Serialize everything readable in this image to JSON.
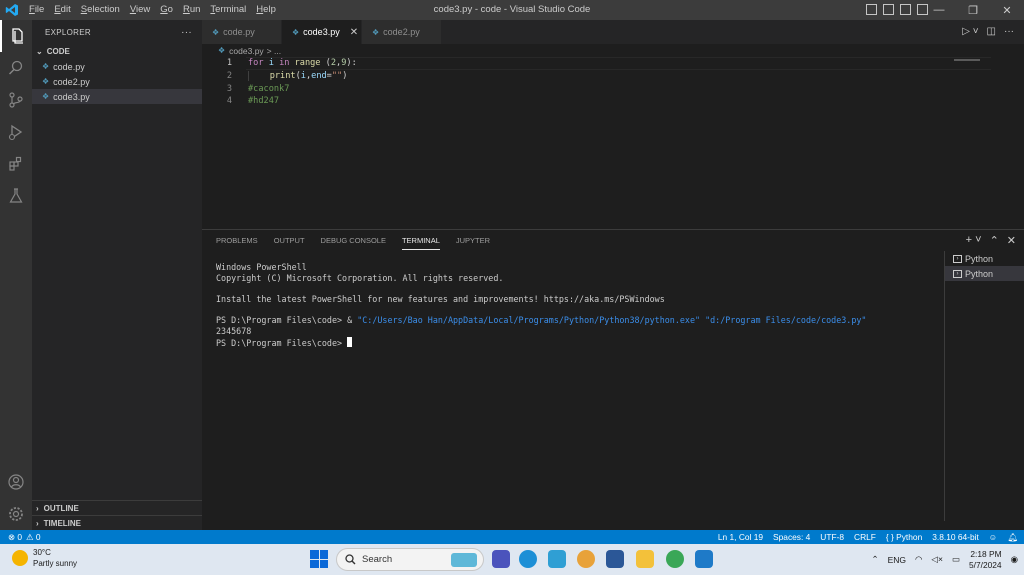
{
  "titlebar": {
    "menu": [
      "File",
      "Edit",
      "Selection",
      "View",
      "Go",
      "Run",
      "Terminal",
      "Help"
    ],
    "title": "code3.py - code - Visual Studio Code",
    "window_controls": [
      "—",
      "❐",
      "✕"
    ]
  },
  "colors": {
    "accent": "#007acc",
    "editor_bg": "#1e1e1e",
    "sidebar_bg": "#252526",
    "activitybar_bg": "#333333"
  },
  "activitybar": [
    "explorer-icon",
    "search-icon",
    "source-control-icon",
    "run-debug-icon",
    "extensions-icon",
    "testing-icon",
    "account-icon",
    "manage-gear-icon"
  ],
  "sidebar": {
    "title": "EXPLORER",
    "more": "···",
    "folder": "CODE",
    "files": [
      "code.py",
      "code2.py",
      "code3.py"
    ],
    "sections": [
      "OUTLINE",
      "TIMELINE"
    ]
  },
  "tabs": [
    {
      "label": "code.py",
      "active": false
    },
    {
      "label": "code3.py",
      "active": true
    },
    {
      "label": "code2.py",
      "active": false
    }
  ],
  "breadcrumb": {
    "file": "code3.py",
    "sep": "> ..."
  },
  "editor": {
    "line_numbers": [
      "1",
      "2",
      "3",
      "4"
    ],
    "line1": {
      "kw1": "for",
      "var": " i ",
      "kw2": "in",
      "fn": " range",
      "open": " (",
      "n1": "2",
      "comma": ",",
      "n2": "9",
      "close": "):"
    },
    "line2": {
      "indent": "    ",
      "fn": "print",
      "open": "(",
      "var": "i",
      "comma": ",",
      "kwarg": "end",
      "eq": "=",
      "str": "\"\"",
      "close": ")"
    },
    "line3": "#caconk7",
    "line4": "#hd247"
  },
  "panel": {
    "tabs": [
      "PROBLEMS",
      "OUTPUT",
      "DEBUG CONSOLE",
      "TERMINAL",
      "JUPYTER"
    ],
    "active_tab": "TERMINAL",
    "terminal": {
      "l1": "Windows PowerShell",
      "l2": "Copyright (C) Microsoft Corporation. All rights reserved.",
      "l3": "",
      "l4": "Install the latest PowerShell for new features and improvements! https://aka.ms/PSWindows",
      "l5": "",
      "l6_prompt": "PS D:\\Program Files\\code> & ",
      "l6_str": "\"C:/Users/Bao Han/AppData/Local/Programs/Python/Python38/python.exe\" \"d:/Program Files/code/code3.py\"",
      "l7": "2345678",
      "l8": "PS D:\\Program Files\\code> "
    },
    "terminal_list": [
      "Python",
      "Python"
    ]
  },
  "statusbar": {
    "errors": "⊗ 0",
    "warnings": "⚠ 0",
    "position": "Ln 1, Col 19",
    "spaces": "Spaces: 4",
    "encoding": "UTF-8",
    "eol": "CRLF",
    "language": "{ } Python",
    "interpreter": "3.8.10 64-bit"
  },
  "taskbar": {
    "weather_temp": "30°C",
    "weather_desc": "Partly sunny",
    "search_placeholder": "Search",
    "lang": "ENG",
    "time": "2:18 PM",
    "date": "5/7/2024"
  }
}
